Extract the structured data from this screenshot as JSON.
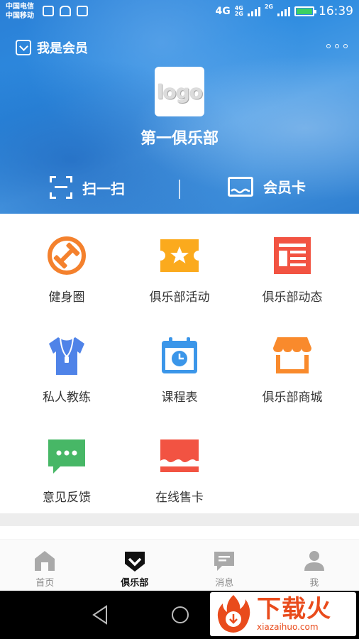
{
  "status_bar": {
    "carrier_1": "中国电信",
    "carrier_2": "中国移动",
    "network": "4G",
    "network_2a": "4G",
    "network_2b": "2G",
    "network_3": "2G",
    "time": "16:39"
  },
  "header": {
    "member_label": "我是会员",
    "logo_text": "logo",
    "club_name": "第一俱乐部",
    "scan_label": "扫一扫",
    "card_label": "会员卡"
  },
  "grid": {
    "items": [
      {
        "label": "健身圈",
        "icon": "dumbbell-icon",
        "color": "#f4812d"
      },
      {
        "label": "俱乐部活动",
        "icon": "ticket-star-icon",
        "color": "#fbaa1d"
      },
      {
        "label": "俱乐部动态",
        "icon": "news-icon",
        "color": "#f25342"
      },
      {
        "label": "私人教练",
        "icon": "coach-shirt-icon",
        "color": "#4f83e8"
      },
      {
        "label": "课程表",
        "icon": "calendar-clock-icon",
        "color": "#3b96e9"
      },
      {
        "label": "俱乐部商城",
        "icon": "shop-icon",
        "color": "#f98a2c"
      },
      {
        "label": "意见反馈",
        "icon": "chat-bubble-icon",
        "color": "#47b766"
      },
      {
        "label": "在线售卡",
        "icon": "card-sale-icon",
        "color": "#f25342"
      }
    ]
  },
  "tabbar": {
    "tabs": [
      {
        "label": "首页",
        "icon": "home-icon",
        "active": false
      },
      {
        "label": "俱乐部",
        "icon": "club-icon",
        "active": true
      },
      {
        "label": "消息",
        "icon": "message-icon",
        "active": false
      },
      {
        "label": "我",
        "icon": "profile-icon",
        "active": false
      }
    ]
  },
  "watermark": {
    "big": "下载火",
    "small": "xiazaihuo.com"
  }
}
